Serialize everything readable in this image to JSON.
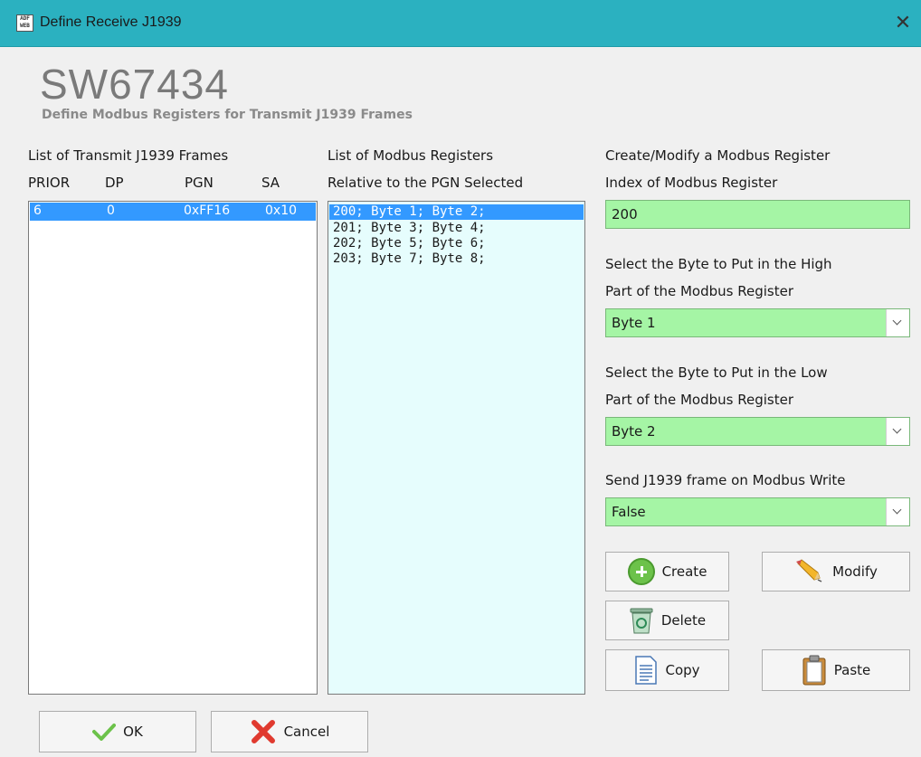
{
  "window": {
    "title": "Define Receive J1939",
    "close_glyph": "✕",
    "icon_text": "ADF WEB"
  },
  "brand": {
    "name": "SW67434",
    "subtitle": "Define Modbus Registers for Transmit J1939 Frames"
  },
  "frames": {
    "heading": "List of Transmit J1939 Frames",
    "columns": [
      "PRIOR",
      "DP",
      "PGN",
      "SA"
    ],
    "rows": [
      {
        "prior": "6",
        "dp": "0",
        "pgn": "0xFF16",
        "sa": "0x10",
        "selected": true
      }
    ]
  },
  "registers": {
    "heading": "List of Modbus Registers",
    "subheading": "Relative to the PGN Selected",
    "items": [
      "200; Byte 1; Byte 2;",
      "201; Byte 3; Byte 4;",
      "202; Byte 5; Byte 6;",
      "203; Byte 7; Byte 8;"
    ]
  },
  "editor": {
    "heading": "Create/Modify a Modbus Register",
    "index_label": "Index of Modbus Register",
    "index_value": "200",
    "high_label_1": "Select the Byte to Put in the High",
    "high_label_2": "Part of the Modbus Register",
    "high_value": "Byte 1",
    "low_label_1": "Select the Byte to Put in the Low",
    "low_label_2": "Part of the Modbus Register",
    "low_value": "Byte 2",
    "send_label": "Send J1939 frame on Modbus Write",
    "send_value": "False"
  },
  "buttons": {
    "create": "Create",
    "modify": "Modify",
    "delete": "Delete",
    "copy": "Copy",
    "paste": "Paste",
    "ok": "OK",
    "cancel": "Cancel"
  },
  "icons": {
    "app": "adfweb-logo-icon",
    "close": "close-icon",
    "create": "plus-circle-icon",
    "modify": "pencil-icon",
    "delete": "trash-bin-icon",
    "copy": "document-icon",
    "paste": "clipboard-icon",
    "ok": "checkmark-icon",
    "cancel": "red-x-icon",
    "dropdown": "chevron-down-icon"
  },
  "colors": {
    "titlebar": "#2bb1c0",
    "input_bg": "#a5f5a5",
    "selection": "#3399ff",
    "register_list_bg": "#e6fdfd"
  }
}
